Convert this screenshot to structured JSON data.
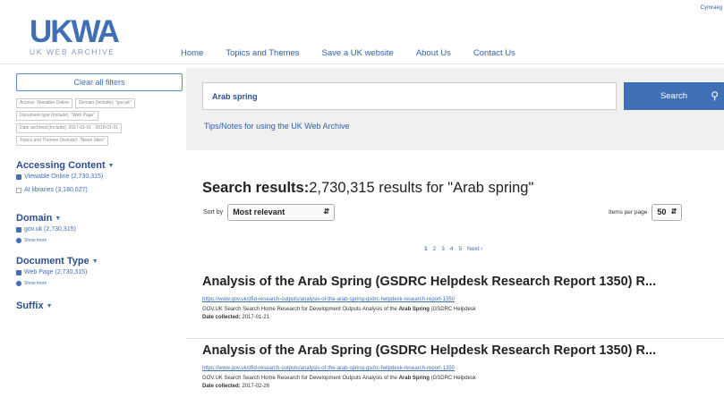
{
  "header": {
    "logo_text": "UKWA",
    "logo_subtext": "UK WEB ARCHIVE",
    "top_right": "Cymraeg",
    "nav": [
      "Home",
      "Topics and Themes",
      "Save a UK website",
      "About Us",
      "Contact Us"
    ]
  },
  "sidebar": {
    "clear_label": "Clear all filters",
    "filters": [
      "Access: Viewable Online",
      "Domain (Include): \"gov.uk\"",
      "Document type (Include): \"Web Page\"",
      "Date archived (Include): 2017-01-01 - 2018-01-01",
      "Topics and Themes (Include): \"News Sites\""
    ],
    "facets": {
      "accessing": {
        "title": "Accessing Content",
        "items": [
          "Viewable Online (2,730,315)",
          "At libraries (3,180,027)"
        ]
      },
      "domain": {
        "title": "Domain",
        "item": "gov.uk (2,730,315)",
        "show_more": "Show more"
      },
      "doctype": {
        "title": "Document Type",
        "item": "Web Page (2,730,315)",
        "show_more": "Show more"
      },
      "suffix": {
        "title": "Suffix"
      }
    }
  },
  "search": {
    "value": "Arab spring",
    "button_label": "Search",
    "tips_link": "Tips/Notes for using the UK Web Archive"
  },
  "results": {
    "heading_prefix": "Search results:",
    "heading_rest": "2,730,315 results for \"Arab spring\"",
    "sort_label": "Sort by",
    "sort_value": "Most relevant",
    "ipp_label": "Items per page",
    "ipp_value": "50",
    "pages": [
      "1",
      "2",
      "3",
      "4",
      "5"
    ],
    "next_label": "Next ›",
    "items": [
      {
        "title": "Analysis of the Arab Spring (GSDRC Helpdesk Research Report 1350) R...",
        "url": "https://www.gov.uk/dfid-research-outputs/analysis-of-the-arab-spring-gsdrc-helpdesk-research-report-1350",
        "snippet_before": "GOV.UK Search Search Home Research for Development Outputs Analysis of the ",
        "snippet_bold": "Arab Spring",
        "snippet_after": " (GSDRC Helpdesk",
        "date_label": "Date collected:",
        "date_value": "2017-01-21"
      },
      {
        "title": "Analysis of the Arab Spring (GSDRC Helpdesk Research Report 1350) R...",
        "url": "https://www.gov.uk/dfid-research-outputs/analysis-of-the-arab-spring-gsdrc-helpdesk-research-report-1350",
        "snippet_before": "GOV.UK Search Search Home Research for Development Outputs Analysis of the ",
        "snippet_bold": "Arab Spring",
        "snippet_after": " (GSDRC Helpdesk",
        "date_label": "Date collected:",
        "date_value": "2017-02-26"
      }
    ]
  }
}
